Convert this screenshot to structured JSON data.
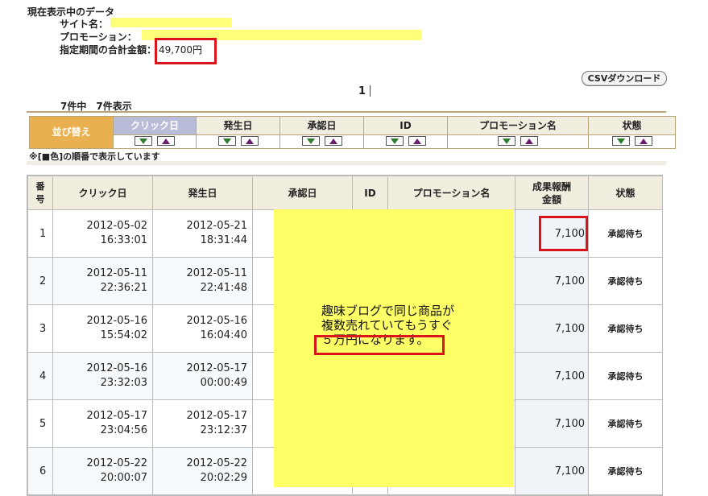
{
  "summary": {
    "title": "現在表示中のデータ",
    "site_label": "サイト名：",
    "promotion_label": "プロモーション：",
    "total_label": "指定期間の合計金額：",
    "total_value": "49,700円"
  },
  "pagination": {
    "current_page": "1"
  },
  "csv_button_label": "CSVダウンロード",
  "count_text": "7件中　7件表示",
  "sort": {
    "label": "並び替え",
    "columns": [
      "クリック日",
      "発生日",
      "承認日",
      "ID",
      "プロモーション名",
      "状態"
    ],
    "active_column": "クリック日",
    "note": "※[■色]の順番で表示しています"
  },
  "table": {
    "headers": {
      "number": "番号",
      "click_date": "クリック日",
      "occur_date": "発生日",
      "approve_date": "承認日",
      "id": "ID",
      "promotion": "プロモーション名",
      "reward": "成果報酬金額",
      "status": "状態"
    },
    "rows": [
      {
        "no": "1",
        "click_date": "2012-05-02",
        "click_time": "16:33:01",
        "occur_date": "2012-05-21",
        "occur_time": "18:31:44",
        "amount": "7,100",
        "status": "承認待ち"
      },
      {
        "no": "2",
        "click_date": "2012-05-11",
        "click_time": "22:36:21",
        "occur_date": "2012-05-11",
        "occur_time": "22:41:48",
        "amount": "7,100",
        "status": "承認待ち"
      },
      {
        "no": "3",
        "click_date": "2012-05-16",
        "click_time": "15:54:02",
        "occur_date": "2012-05-16",
        "occur_time": "16:04:40",
        "amount": "7,100",
        "status": "承認待ち"
      },
      {
        "no": "4",
        "click_date": "2012-05-16",
        "click_time": "23:32:03",
        "occur_date": "2012-05-17",
        "occur_time": "00:00:49",
        "amount": "7,100",
        "status": "承認待ち"
      },
      {
        "no": "5",
        "click_date": "2012-05-17",
        "click_time": "23:04:56",
        "occur_date": "2012-05-17",
        "occur_time": "23:12:37",
        "amount": "7,100",
        "status": "承認待ち"
      },
      {
        "no": "6",
        "click_date": "2012-05-22",
        "click_time": "20:00:07",
        "occur_date": "2012-05-22",
        "occur_time": "20:02:29",
        "amount": "7,100",
        "status": "承認待ち"
      }
    ]
  },
  "note": {
    "line1": "趣味ブログで同じ商品が",
    "line2": "複数売れていてもうすぐ",
    "line3": "５万円になります。"
  },
  "colors": {
    "highlight_yellow": "#ffff66",
    "annotation_red": "#d9151b",
    "sort_label_orange": "#e8b04f",
    "active_sort_header": "#b9bcd8"
  }
}
